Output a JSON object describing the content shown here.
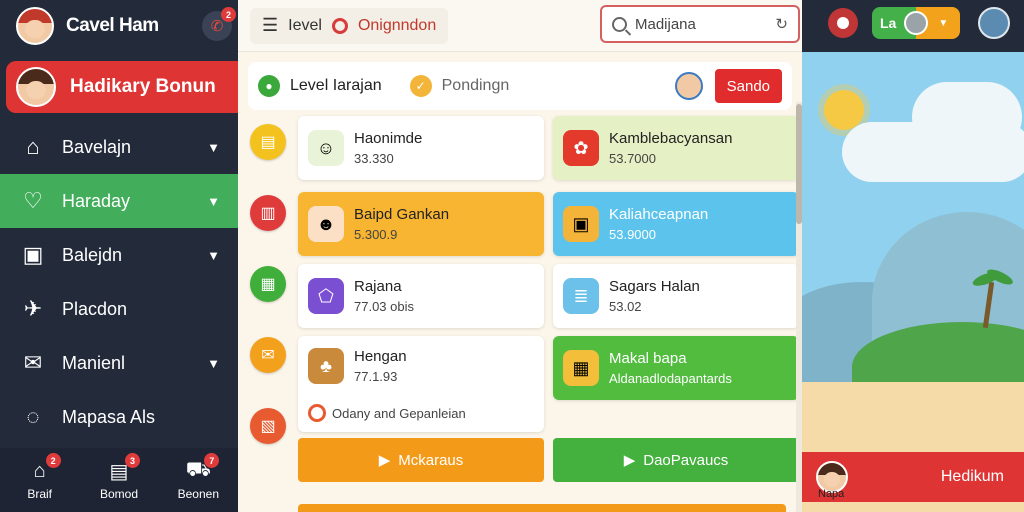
{
  "sidebar": {
    "title": "Cavel Ham",
    "notif_count": "2",
    "profile_label": "Hadikary Bonun",
    "items": [
      {
        "label": "Bavelajn",
        "icon": "home-icon"
      },
      {
        "label": "Haraday",
        "icon": "heart-icon"
      },
      {
        "label": "Balejdn",
        "icon": "bag-icon"
      },
      {
        "label": "Placdon",
        "icon": "plane-icon"
      },
      {
        "label": "Manienl",
        "icon": "mail-icon"
      },
      {
        "label": "Mapasa Als",
        "icon": "search-icon"
      }
    ],
    "bottom": [
      {
        "label": "Braif",
        "badge": "2",
        "icon": "home-icon"
      },
      {
        "label": "Bomod",
        "badge": "3",
        "icon": "box-icon"
      },
      {
        "label": "Beonen",
        "badge": "7",
        "icon": "cart-icon"
      }
    ]
  },
  "topbar": {
    "crumb1": "Ievel",
    "crumb2": "Onignndon",
    "search_value": "Madijana"
  },
  "right_header": {
    "level_label": "La"
  },
  "subbar": {
    "tab1": "Level Iarajan",
    "tab2": "Pondingn",
    "button": "Sando"
  },
  "cards": [
    {
      "title": "Haonimde",
      "value": "33.330"
    },
    {
      "title": "Kamblebacyansan",
      "value": "53.7000"
    },
    {
      "title": "Baipd Gankan",
      "value": "5.300.9"
    },
    {
      "title": "Kaliahceapnan",
      "value": "53.9000"
    },
    {
      "title": "Rajana",
      "value": "77.03 obis"
    },
    {
      "title": "Sagars Halan",
      "value": "53.02"
    },
    {
      "title": "Hengan",
      "value": "77.1.93",
      "footer": "Odany and Gepanleian"
    },
    {
      "title": "Makal bapa",
      "value": "Aldanadlodapantards"
    }
  ],
  "actions": {
    "left": "Mckaraus",
    "right": "DaoPavaucs"
  },
  "scene": {
    "sub": "Napa",
    "main": "Hedikum"
  },
  "colors": {
    "accent_red": "#df3434",
    "accent_green": "#42ad5b",
    "orange": "#f39a18"
  }
}
